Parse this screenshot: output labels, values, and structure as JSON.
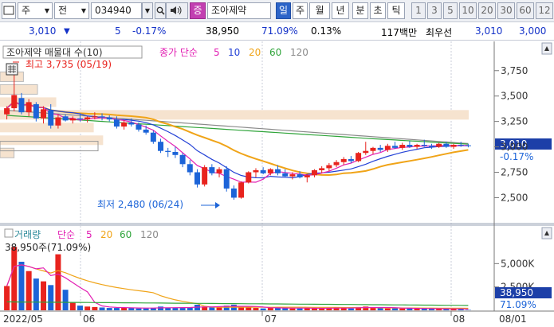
{
  "toolbar": {
    "type_value": "주",
    "type2_value": "전",
    "code_value": "034940",
    "stock_name": "조아제약",
    "period_tabs": [
      "일",
      "주",
      "월",
      "년",
      "분",
      "초",
      "틱"
    ],
    "minute_options": [
      "1",
      "3",
      "5",
      "10",
      "20",
      "30",
      "60",
      "12"
    ]
  },
  "quote": {
    "price": "3,010",
    "change": "5",
    "change_pct": "-0.17%",
    "volume": "38,950",
    "volume_ratio": "71.09%",
    "turnover_rate": "0.13%",
    "amount": "117백만",
    "priority_label": "최우선",
    "bid": "3,010",
    "ask": "3,000"
  },
  "price_panel": {
    "title": "조아제약 매물대 수(10)",
    "legend_prefix": "종가 단순",
    "ma_labels": [
      "5",
      "10",
      "20",
      "60",
      "120"
    ],
    "high_annotation": "최고 3,735 (05/19)",
    "low_annotation": "최저 2,480 (06/24)",
    "price_badge": "3,010",
    "change_badge": "-0.17%",
    "y_ticks": [
      "3,750",
      "3,500",
      "3,250",
      "3,000",
      "2,750",
      "2,500"
    ]
  },
  "volume_panel": {
    "title": "거래량",
    "legend_prefix": "단순",
    "ma_labels": [
      "5",
      "20",
      "60",
      "120"
    ],
    "current_volume": "38,950주(71.09%)",
    "volume_badge": "38,950",
    "ratio_badge": "71.09%",
    "y_ticks": [
      "5,000K",
      "2,500K"
    ]
  },
  "x_axis": {
    "labels": [
      "2022/05",
      "06",
      "07",
      "08",
      "08/01"
    ]
  },
  "colors": {
    "up": "#e8231e",
    "down": "#1c64d8",
    "ma5": "#e21fb3",
    "ma10": "#2442d6",
    "ma20": "#f0a418",
    "ma60": "#2fa43a",
    "ma120": "#8a8a8a",
    "volume_profile": "#f6e3cf"
  },
  "chart_data": {
    "type": "candlestick",
    "ohlc": [
      [
        3320,
        3400,
        3270,
        3380
      ],
      [
        3380,
        3735,
        3350,
        3510
      ],
      [
        3480,
        3530,
        3320,
        3340
      ],
      [
        3340,
        3470,
        3300,
        3440
      ],
      [
        3420,
        3440,
        3250,
        3280
      ],
      [
        3280,
        3400,
        3230,
        3370
      ],
      [
        3360,
        3420,
        3180,
        3210
      ],
      [
        3210,
        3320,
        3180,
        3290
      ],
      [
        3300,
        3320,
        3250,
        3260
      ],
      [
        3260,
        3300,
        3230,
        3280
      ],
      [
        3280,
        3330,
        3250,
        3270
      ],
      [
        3270,
        3300,
        3240,
        3290
      ],
      [
        3290,
        3340,
        3270,
        3300
      ],
      [
        3300,
        3330,
        3260,
        3290
      ],
      [
        3290,
        3310,
        3250,
        3270
      ],
      [
        3270,
        3300,
        3180,
        3200
      ],
      [
        3200,
        3260,
        3170,
        3240
      ],
      [
        3240,
        3280,
        3200,
        3220
      ],
      [
        3220,
        3240,
        3150,
        3170
      ],
      [
        3170,
        3210,
        3120,
        3140
      ],
      [
        3140,
        3160,
        3030,
        3050
      ],
      [
        3050,
        3080,
        2940,
        2960
      ],
      [
        2960,
        2990,
        2900,
        2950
      ],
      [
        2950,
        3000,
        2890,
        2920
      ],
      [
        2920,
        2940,
        2800,
        2830
      ],
      [
        2830,
        2870,
        2720,
        2750
      ],
      [
        2750,
        2780,
        2600,
        2630
      ],
      [
        2630,
        2820,
        2610,
        2800
      ],
      [
        2800,
        2830,
        2720,
        2740
      ],
      [
        2740,
        2800,
        2700,
        2780
      ],
      [
        2780,
        2810,
        2560,
        2590
      ],
      [
        2590,
        2620,
        2480,
        2500
      ],
      [
        2500,
        2660,
        2490,
        2650
      ],
      [
        2650,
        2760,
        2640,
        2750
      ],
      [
        2750,
        2790,
        2700,
        2770
      ],
      [
        2770,
        2800,
        2730,
        2740
      ],
      [
        2740,
        2790,
        2720,
        2780
      ],
      [
        2780,
        2820,
        2720,
        2740
      ],
      [
        2740,
        2780,
        2700,
        2710
      ],
      [
        2710,
        2750,
        2680,
        2730
      ],
      [
        2730,
        2760,
        2690,
        2700
      ],
      [
        2700,
        2730,
        2650,
        2720
      ],
      [
        2720,
        2780,
        2700,
        2770
      ],
      [
        2770,
        2810,
        2740,
        2790
      ],
      [
        2790,
        2840,
        2760,
        2820
      ],
      [
        2820,
        2870,
        2800,
        2850
      ],
      [
        2850,
        2900,
        2820,
        2880
      ],
      [
        2880,
        2910,
        2840,
        2860
      ],
      [
        2860,
        2950,
        2850,
        2940
      ],
      [
        2940,
        3050,
        2920,
        2960
      ],
      [
        2960,
        3000,
        2930,
        2990
      ],
      [
        2990,
        3020,
        2950,
        2970
      ],
      [
        2970,
        3030,
        2950,
        3010
      ],
      [
        3010,
        3050,
        2980,
        2990
      ],
      [
        2990,
        3040,
        2970,
        3020
      ],
      [
        3020,
        3060,
        2990,
        3000
      ],
      [
        3000,
        3030,
        2980,
        3020
      ],
      [
        3020,
        3070,
        3000,
        3010
      ],
      [
        3010,
        3030,
        2980,
        3000
      ],
      [
        3000,
        3040,
        2990,
        3030
      ],
      [
        3030,
        3050,
        2990,
        3000
      ],
      [
        3000,
        3030,
        2980,
        3020
      ],
      [
        3020,
        3050,
        3000,
        3015
      ],
      [
        3015,
        3030,
        2995,
        3010
      ]
    ],
    "volume": [
      2600,
      6800,
      5200,
      4200,
      3400,
      3100,
      2700,
      6000,
      2200,
      800,
      500,
      400,
      350,
      300,
      250,
      250,
      300,
      250,
      200,
      200,
      250,
      400,
      300,
      250,
      250,
      300,
      600,
      400,
      300,
      350,
      500,
      600,
      400,
      300,
      250,
      200,
      250,
      300,
      250,
      200,
      200,
      250,
      200,
      200,
      250,
      300,
      250,
      200,
      350,
      400,
      300,
      250,
      200,
      250,
      200,
      200,
      180,
      170,
      160,
      150,
      140,
      160,
      150,
      39
    ],
    "volume_profile": [
      {
        "price": 3690,
        "width": 0.05
      },
      {
        "price": 3565,
        "width": 0.08
      },
      {
        "price": 3440,
        "width": 0.12
      },
      {
        "price": 3315,
        "width": 1.0
      },
      {
        "price": 3190,
        "width": 0.2
      },
      {
        "price": 3065,
        "width": 0.22
      },
      {
        "price": 2940,
        "width": 0.03
      }
    ],
    "ylim": [
      2300,
      3850
    ],
    "volume_ylim": [
      0,
      7500
    ]
  }
}
